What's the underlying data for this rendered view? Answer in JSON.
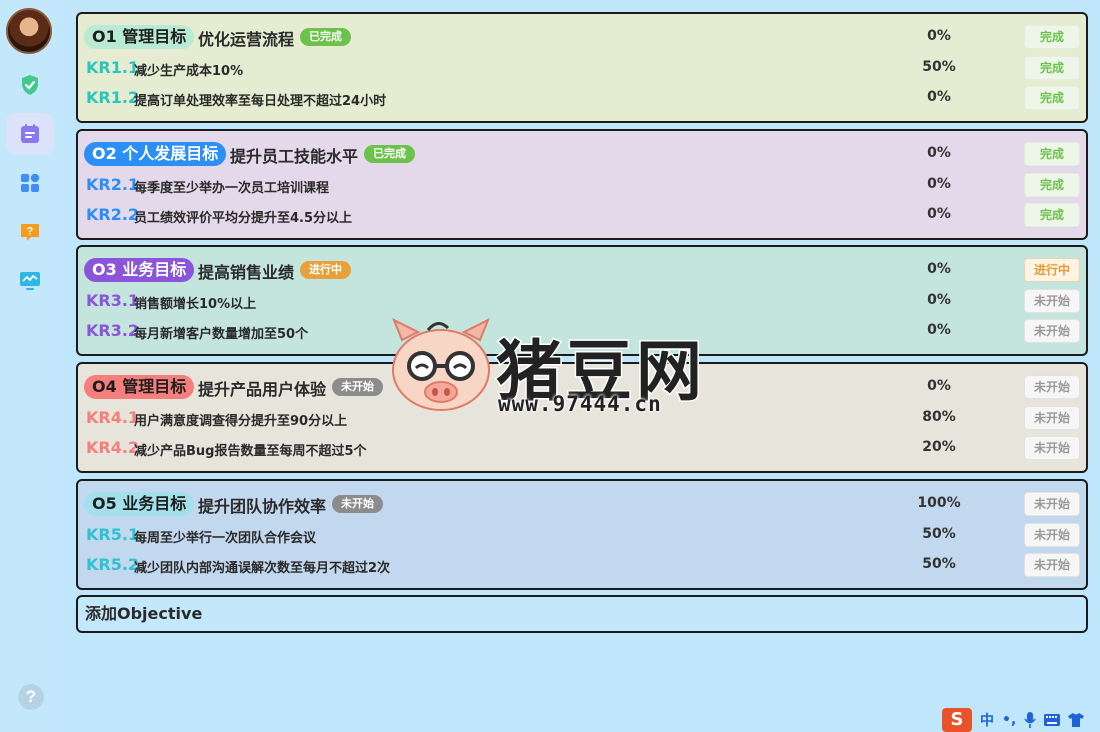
{
  "sidebar": {
    "avatar": "user-avatar",
    "items": [
      {
        "name": "shield-check-icon",
        "color": "#43c98b"
      },
      {
        "name": "calendar-icon",
        "color": "#7c6cf0",
        "active": true
      },
      {
        "name": "apps-grid-icon",
        "color": "#3e8ef7"
      },
      {
        "name": "question-bubble-icon",
        "color": "#f59c1a"
      },
      {
        "name": "monitor-chart-icon",
        "color": "#2fb6e8"
      }
    ],
    "help": "?"
  },
  "objectives": [
    {
      "code": "O1 管理目标",
      "title": "优化运营流程",
      "status": "已完成",
      "progress": "0%",
      "action": "完成",
      "tag_bg": "#b9ead3",
      "tag_color": "#1e1e1e",
      "card_bg": "#e6ecd1",
      "kr_color": "#2ac7c0",
      "badge_bg": "#6cc24a",
      "status_kind": "done",
      "krs": [
        {
          "code": "KR1.1",
          "text": "减少生产成本10%",
          "progress": "50%",
          "action": "完成",
          "status_kind": "done"
        },
        {
          "code": "KR1.2",
          "text": "提高订单处理效率至每日处理不超过24小时",
          "progress": "0%",
          "action": "完成",
          "status_kind": "done"
        }
      ]
    },
    {
      "code": "O2 个人发展目标",
      "title": "提升员工技能水平",
      "status": "已完成",
      "progress": "0%",
      "action": "完成",
      "tag_bg": "#2b8ff6",
      "tag_color": "#ffffff",
      "card_bg": "#e4d9ea",
      "kr_color": "#2b8ff6",
      "badge_bg": "#6cc24a",
      "status_kind": "done",
      "krs": [
        {
          "code": "KR2.1",
          "text": "每季度至少举办一次员工培训课程",
          "progress": "0%",
          "action": "完成",
          "status_kind": "done"
        },
        {
          "code": "KR2.2",
          "text": "员工绩效评价平均分提升至4.5分以上",
          "progress": "0%",
          "action": "完成",
          "status_kind": "done"
        }
      ]
    },
    {
      "code": "O3 业务目标",
      "title": "提高销售业绩",
      "status": "进行中",
      "progress": "0%",
      "action": "进行中",
      "tag_bg": "#8a55d8",
      "tag_color": "#ffffff",
      "card_bg": "#c4e5de",
      "kr_color": "#8a55d8",
      "badge_bg": "#e8a13a",
      "status_kind": "progress",
      "krs": [
        {
          "code": "KR3.1",
          "text": "销售额增长10%以上",
          "progress": "0%",
          "action": "未开始",
          "status_kind": "todo"
        },
        {
          "code": "KR3.2",
          "text": "每月新增客户数量增加至50个",
          "progress": "0%",
          "action": "未开始",
          "status_kind": "todo"
        }
      ]
    },
    {
      "code": "O4 管理目标",
      "title": "提升产品用户体验",
      "status": "未开始",
      "progress": "0%",
      "action": "未开始",
      "tag_bg": "#f47f7c",
      "tag_color": "#1e1e1e",
      "card_bg": "#e6e4db",
      "kr_color": "#f47f7c",
      "badge_bg": "#8c8c8c",
      "status_kind": "todo",
      "krs": [
        {
          "code": "KR4.1",
          "text": "用户满意度调查得分提升至90分以上",
          "progress": "80%",
          "action": "未开始",
          "status_kind": "todo"
        },
        {
          "code": "KR4.2",
          "text": "减少产品Bug报告数量至每周不超过5个",
          "progress": "20%",
          "action": "未开始",
          "status_kind": "todo"
        }
      ]
    },
    {
      "code": "O5 业务目标",
      "title": "提升团队协作效率",
      "status": "未开始",
      "progress": "100%",
      "action": "未开始",
      "tag_bg": "#a3e0ec",
      "tag_color": "#1e1e1e",
      "card_bg": "#c2d8ef",
      "kr_color": "#2ec2d0",
      "badge_bg": "#8c8c8c",
      "status_kind": "todo",
      "krs": [
        {
          "code": "KR5.1",
          "text": "每周至少举行一次团队合作会议",
          "progress": "50%",
          "action": "未开始",
          "status_kind": "todo"
        },
        {
          "code": "KR5.2",
          "text": "减少团队内部沟通误解次数至每月不超过2次",
          "progress": "50%",
          "action": "未开始",
          "status_kind": "todo"
        }
      ]
    }
  ],
  "add_objective_label": "添加Objective",
  "watermark": {
    "brand": "猪豆网",
    "url": "www.97444.cn",
    "icon": "pig-logo-icon"
  },
  "ime": {
    "logo": "S",
    "mode": "中",
    "punct": "•,",
    "icons": [
      "microphone-icon",
      "keyboard-icon",
      "skin-shirt-icon"
    ]
  }
}
